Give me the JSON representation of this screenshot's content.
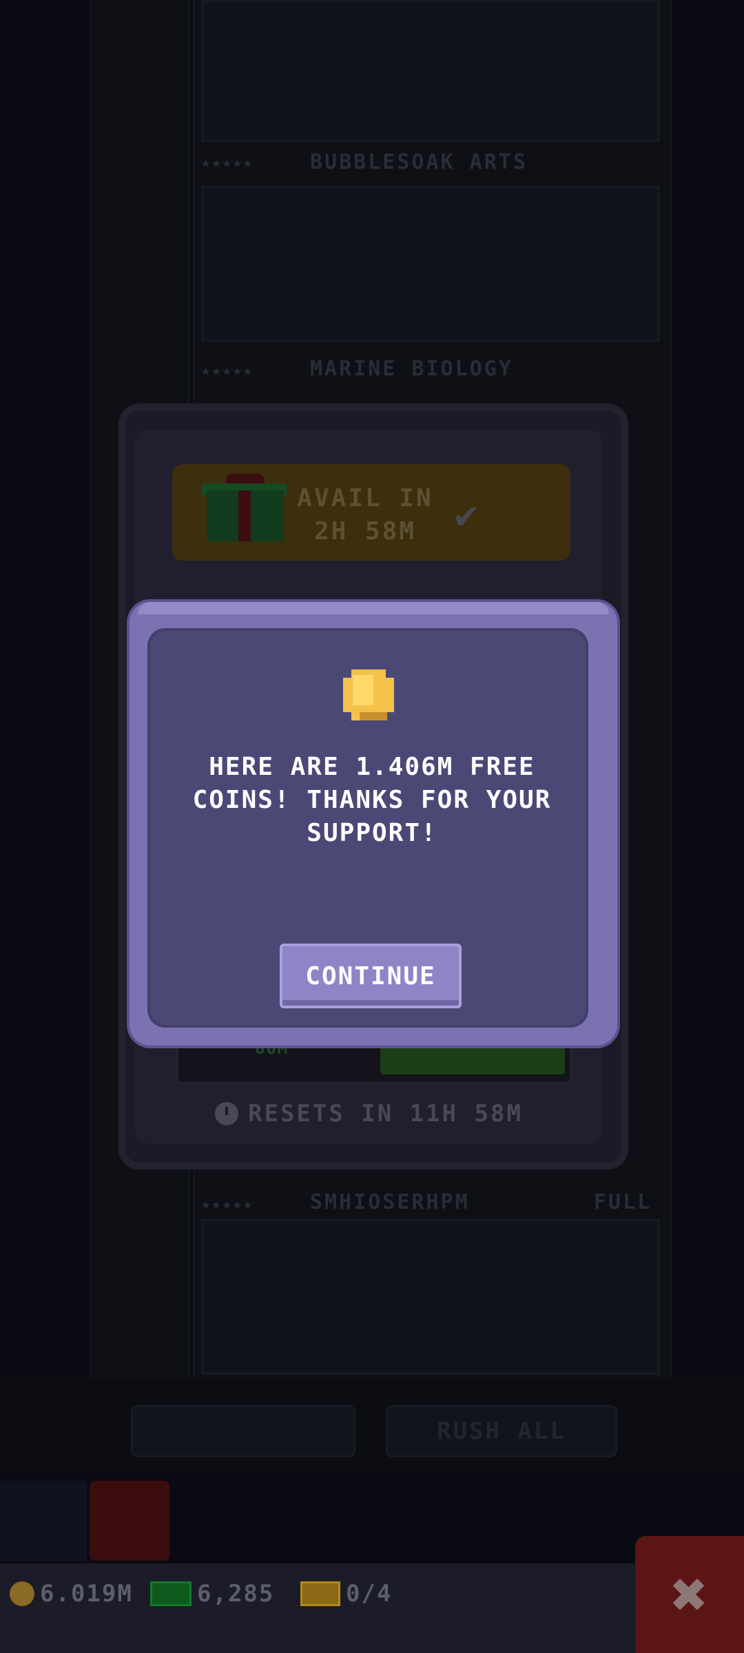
{
  "background": {
    "floors": [
      {
        "stars": "★★★★★",
        "name": "BUBBLESOAK ARTS"
      },
      {
        "stars": "★★★★★",
        "name": "MARINE BIOLOGY"
      },
      {
        "stars": "★★★★★",
        "name": "SMHIOSERHPM",
        "status": "FULL"
      }
    ],
    "buttons": {
      "left": "",
      "right": "RUSH ALL"
    }
  },
  "back_panel": {
    "gift": {
      "line1": "AVAIL IN",
      "line2": "2H 58M",
      "icon": "gift-icon",
      "status_icon": "check-icon"
    },
    "lower_left": "60M",
    "resets": "RESETS IN 11H 58M"
  },
  "dialog": {
    "icon": "coin-icon",
    "message": "HERE ARE 1.406M FREE COINS! THANKS FOR YOUR SUPPORT!",
    "continue_label": "CONTINUE"
  },
  "hud": {
    "coins": "6.019M",
    "bux": "6,285",
    "tickets": "0/4",
    "close_icon": "close-icon"
  },
  "colors": {
    "dialog_outer": "#7b72b2",
    "dialog_inner": "#4c4876",
    "button": "#8e85c6",
    "coin": "#f4c24a"
  }
}
